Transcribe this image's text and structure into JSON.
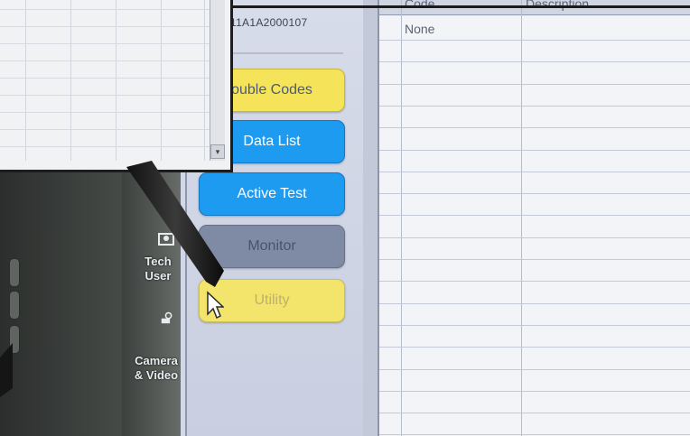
{
  "device": {
    "vin_partial": "11A1A2000107",
    "side_buttons": [
      {
        "label_line1": "Tech",
        "label_line2": "User"
      },
      {
        "label_line1": "Camera",
        "label_line2": "& Video"
      }
    ]
  },
  "menu": {
    "trouble_codes": "ouble Codes",
    "data_list": "Data List",
    "active_test": "Active Test",
    "monitor": "Monitor",
    "utility": "Utility"
  },
  "codes_table": {
    "headers": [
      "Code",
      "Description"
    ],
    "rows": [
      {
        "code": "None",
        "description": ""
      }
    ]
  },
  "colors": {
    "button_yellow": "#f5e45a",
    "button_blue": "#1d9bf0",
    "button_gray": "#7f8ba5",
    "screen_bg": "#d2d8e7"
  },
  "icons": {
    "tech_user": "user-icon",
    "camera_video": "camera-icon",
    "cursor": "arrow-cursor-icon",
    "scroll_down": "scroll-down-arrow-icon"
  }
}
